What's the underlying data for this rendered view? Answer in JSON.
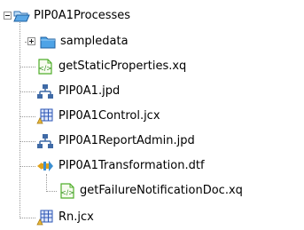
{
  "tree": {
    "root": {
      "label": "PIP0A1Processes",
      "icon": "open-folder-icon",
      "expanded": true
    },
    "items": [
      {
        "label": "sampledata",
        "icon": "folder-icon",
        "collapsed": true
      },
      {
        "label": "getStaticProperties.xq",
        "icon": "xquery-file-icon"
      },
      {
        "label": "PIP0A1.jpd",
        "icon": "process-file-icon"
      },
      {
        "label": "PIP0A1Control.jcx",
        "icon": "control-file-icon"
      },
      {
        "label": "PIP0A1ReportAdmin.jpd",
        "icon": "process-file-icon"
      },
      {
        "label": "PIP0A1Transformation.dtf",
        "icon": "transformation-file-icon"
      },
      {
        "label": "getFailureNotificationDoc.xq",
        "icon": "xquery-file-icon",
        "nested": true
      },
      {
        "label": "Rn.jcx",
        "icon": "control-file-icon"
      }
    ]
  },
  "colors": {
    "folder": "#2f8fd6",
    "xquery": "#4fae2a",
    "process": "#3f6aa6",
    "control": "#2b55b4",
    "connector": "#9a9a9a"
  }
}
